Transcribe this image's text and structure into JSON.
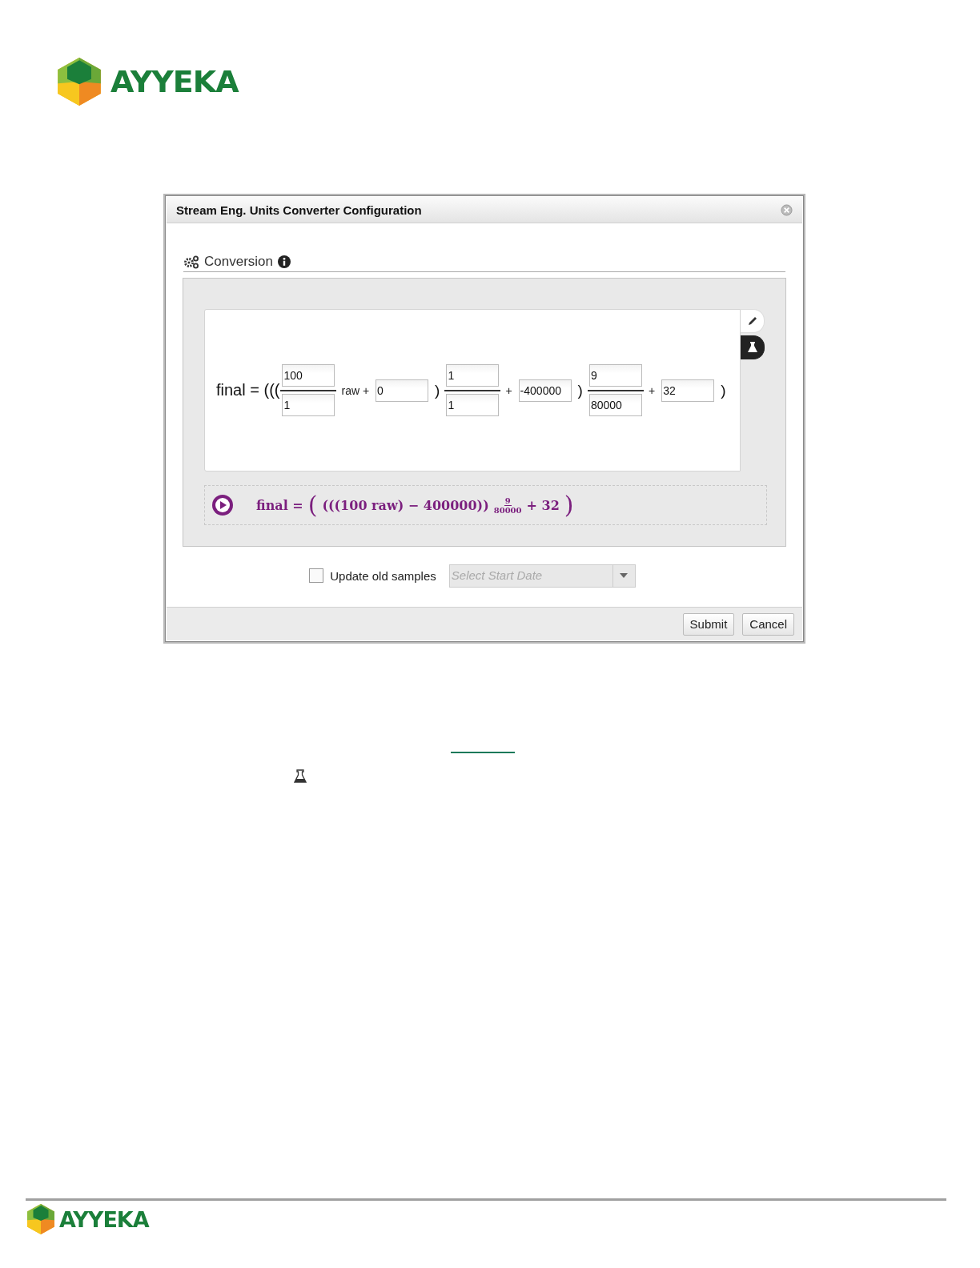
{
  "header": {
    "logo_text": "AYYEKA"
  },
  "dialog": {
    "title": "Stream Eng. Units Converter Configuration",
    "section": {
      "label": "Conversion"
    },
    "equation": [
      {
        "kind": "head",
        "text": "final = ((("
      },
      {
        "kind": "fraction",
        "numerator": "100",
        "denominator": "1"
      },
      {
        "kind": "op",
        "text": "raw +"
      },
      {
        "kind": "input",
        "value": "0"
      },
      {
        "kind": "paren",
        "text": ")"
      },
      {
        "kind": "fraction",
        "numerator": "1",
        "denominator": "1"
      },
      {
        "kind": "op",
        "text": "+"
      },
      {
        "kind": "input",
        "value": "-400000"
      },
      {
        "kind": "paren",
        "text": ")"
      },
      {
        "kind": "fraction",
        "numerator": "9",
        "denominator": "80000"
      },
      {
        "kind": "op",
        "text": "+"
      },
      {
        "kind": "input",
        "value": "32"
      },
      {
        "kind": "paren",
        "text": ")"
      }
    ],
    "preview": {
      "lhs": "final =",
      "open": "(",
      "body": "(((100 raw) − 400000))",
      "numerator": "9",
      "denominator": "80000",
      "tail": "+ 32",
      "close": ")"
    },
    "update_old_samples": {
      "label": "Update old samples",
      "checked": false
    },
    "start_date": {
      "placeholder": "Select Start Date"
    },
    "buttons": [
      "Submit",
      "Cancel"
    ]
  },
  "footer": {
    "logo_text": "AYYEKA"
  }
}
